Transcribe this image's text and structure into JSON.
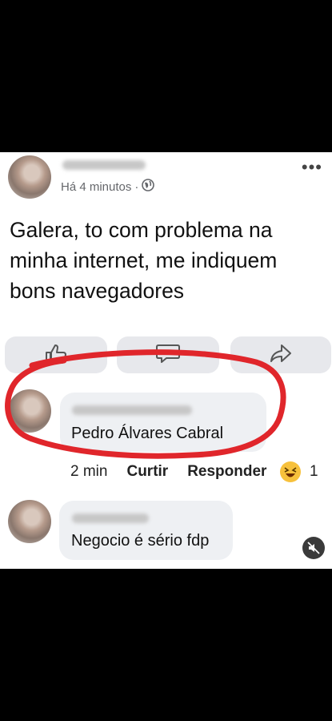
{
  "post": {
    "meta_time": "Há 4 minutos",
    "meta_separator": "·",
    "text": "Galera, to com problema na minha internet, me indiquem bons navegadores",
    "more_icon": "more-horizontal-icon",
    "privacy_icon": "globe-icon"
  },
  "actions": {
    "icons": [
      "like-icon",
      "comment-icon",
      "share-icon"
    ]
  },
  "comments": [
    {
      "text": "Pedro Álvares Cabral",
      "time": "2 min",
      "like_label": "Curtir",
      "reply_label": "Responder",
      "reaction_icon": "laughing-emoji-icon",
      "reaction_count": "1"
    },
    {
      "text": "Negocio é sério fdp"
    }
  ],
  "annotation": {
    "color": "#e0262b"
  },
  "video": {
    "mute_icon": "mute-icon"
  }
}
